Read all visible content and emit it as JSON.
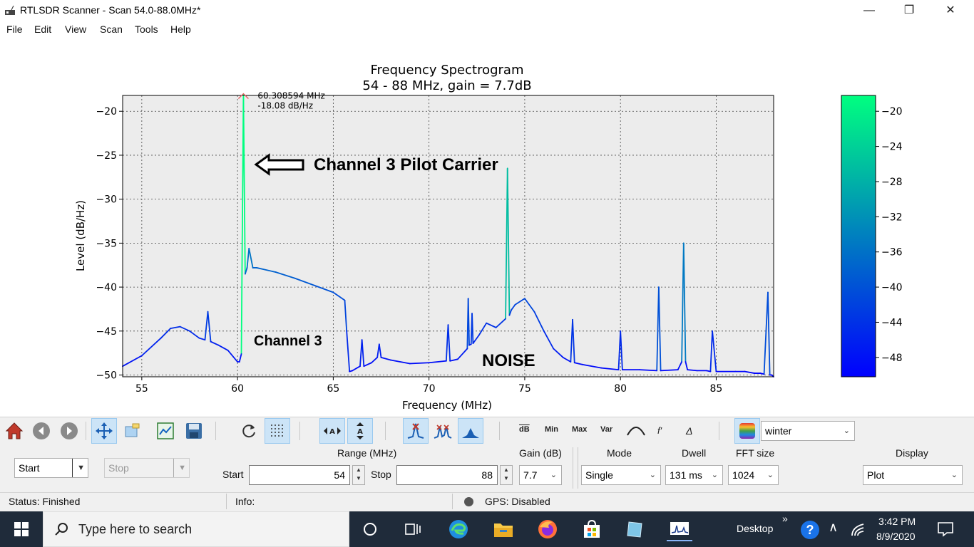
{
  "window": {
    "title": "RTLSDR Scanner - Scan 54.0-88.0MHz*",
    "minimize_icon": "minimize-icon",
    "maximize_icon": "restore-icon",
    "close_icon": "close-icon"
  },
  "menu": [
    "File",
    "Edit",
    "View",
    "Scan",
    "Tools",
    "Help"
  ],
  "chart_data": {
    "type": "line",
    "title": "Frequency Spectrogram",
    "subtitle": "54 - 88 MHz, gain = 7.7dB",
    "xlabel": "Frequency (MHz)",
    "ylabel": "Level (dB/Hz)",
    "xlim": [
      54.0,
      88.0
    ],
    "ylim": [
      -50.2,
      -18.2
    ],
    "xticks": [
      55,
      60,
      65,
      70,
      75,
      80,
      85
    ],
    "yticks": [
      -20,
      -25,
      -30,
      -35,
      -40,
      -45,
      -50
    ],
    "grid": true,
    "colormap": "winter",
    "colorbar": {
      "ticks": [
        -20,
        -24,
        -28,
        -32,
        -36,
        -40,
        -44,
        -48
      ],
      "range": [
        -50.2,
        -18.2
      ]
    },
    "peak_annotation": {
      "freq_text": "60.308594 MHz",
      "level_text": "-18.08 dB/Hz",
      "freq": 60.308594,
      "level": -18.08
    },
    "annotations": [
      "Channel 3 Pilot Carrier",
      "Channel 3",
      "NOISE"
    ],
    "series": [
      {
        "x": [
          54.0,
          55.0,
          56.0,
          56.5,
          57.0,
          57.5,
          58.0,
          58.3,
          58.45,
          58.6,
          59.0,
          59.5,
          60.0,
          60.1,
          60.2,
          60.308594,
          60.4,
          60.5,
          60.6,
          60.8,
          61.0,
          62.0,
          63.0,
          64.0,
          65.0,
          65.6,
          65.7,
          65.85,
          66.0,
          66.4,
          66.5,
          66.6,
          67.0,
          67.3,
          67.4,
          67.5,
          68.0,
          69.0,
          70.0,
          70.9,
          71.0,
          71.1,
          71.5,
          72.0,
          72.05,
          72.1,
          72.2,
          72.25,
          72.3,
          72.6,
          73.0,
          73.5,
          74.0,
          74.1,
          74.2,
          74.3,
          74.5,
          75.0,
          75.5,
          76.0,
          76.5,
          77.0,
          77.4,
          77.5,
          77.6,
          78.0,
          79.0,
          79.9,
          80.0,
          80.1,
          81.0,
          81.9,
          82.0,
          82.1,
          83.0,
          83.2,
          83.3,
          83.4,
          83.5,
          84.0,
          84.5,
          84.7,
          84.8,
          85.0,
          86.0,
          86.5,
          87.0,
          87.3,
          87.5,
          87.7,
          87.8,
          87.9,
          88.0
        ],
        "y": [
          -49.0,
          -47.8,
          -45.8,
          -44.7,
          -44.5,
          -45.0,
          -45.8,
          -46.0,
          -42.8,
          -46.2,
          -46.6,
          -47.2,
          -48.5,
          -48.5,
          -47.6,
          -18.08,
          -38.5,
          -37.8,
          -35.6,
          -37.8,
          -37.8,
          -38.3,
          -39.0,
          -39.8,
          -40.6,
          -41.5,
          -45.0,
          -49.6,
          -49.5,
          -49.0,
          -46.0,
          -49.0,
          -48.6,
          -48.0,
          -46.5,
          -48.0,
          -48.3,
          -48.7,
          -48.6,
          -48.4,
          -44.3,
          -48.4,
          -48.2,
          -47.0,
          -41.3,
          -46.6,
          -46.5,
          -43.0,
          -46.4,
          -45.5,
          -44.1,
          -44.6,
          -43.6,
          -26.5,
          -43.2,
          -42.6,
          -42.0,
          -41.3,
          -42.8,
          -45.0,
          -47.0,
          -48.0,
          -48.5,
          -43.7,
          -48.6,
          -48.8,
          -49.2,
          -49.4,
          -45.0,
          -49.4,
          -49.4,
          -49.5,
          -40.0,
          -49.5,
          -49.4,
          -48.5,
          -35.0,
          -48.5,
          -49.4,
          -49.5,
          -49.5,
          -49.6,
          -45.0,
          -49.6,
          -49.6,
          -49.6,
          -49.8,
          -49.8,
          -49.9,
          -40.6,
          -50.0,
          -50.0,
          -50.2
        ]
      }
    ]
  },
  "toolbar": {
    "buttons": [
      "home-icon",
      "back-icon",
      "forward-icon",
      "pan-icon",
      "zoom-icon",
      "subplot-config-icon",
      "save-icon",
      "refresh-icon",
      "grid-icon",
      "fit-x-icon",
      "fit-y-icon",
      "peak-icon",
      "peaks-icon",
      "fill-icon"
    ],
    "stat_labels": [
      "dB",
      "Min",
      "Max",
      "Var"
    ],
    "smooth_icon": "smooth-icon",
    "diff_label": "f'",
    "delta_label": "Δ",
    "colormap_icon": "colormap-icon",
    "colormap_value": "winter"
  },
  "controls": {
    "start_button": "Start",
    "stop_button": "Stop",
    "range_label": "Range (MHz)",
    "start_label": "Start",
    "start_value": "54",
    "stop_label": "Stop",
    "stop_value": "88",
    "gain_label": "Gain (dB)",
    "gain_value": "7.7",
    "mode_label": "Mode",
    "mode_value": "Single",
    "dwell_label": "Dwell",
    "dwell_value": "131 ms",
    "fft_label": "FFT size",
    "fft_value": "1024",
    "display_label": "Display",
    "display_value": "Plot"
  },
  "status": {
    "status_text": "Status: Finished",
    "info_text": "Info:",
    "gps_text": "GPS: Disabled"
  },
  "taskbar": {
    "search_placeholder": "Type here to search",
    "desktop_label": "Desktop",
    "time": "3:42 PM",
    "date": "8/9/2020"
  }
}
